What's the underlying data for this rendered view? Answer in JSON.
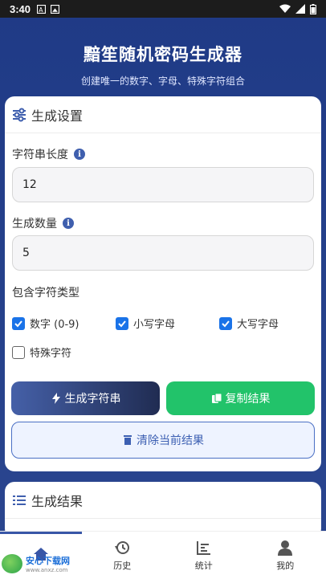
{
  "status_bar": {
    "time": "3:40"
  },
  "header": {
    "title": "黯笙随机密码生成器",
    "subtitle": "创建唯一的数字、字母、特殊字符组合"
  },
  "settings": {
    "title": "生成设置",
    "length_label": "字符串长度",
    "length_value": "12",
    "count_label": "生成数量",
    "count_value": "5",
    "types_label": "包含字符类型",
    "types": [
      {
        "label": "数字 (0-9)",
        "checked": true
      },
      {
        "label": "小写字母",
        "checked": true
      },
      {
        "label": "大写字母",
        "checked": true
      },
      {
        "label": "特殊字符",
        "checked": false
      }
    ],
    "generate_label": "生成字符串",
    "copy_label": "复制结果",
    "clear_label": "清除当前结果"
  },
  "results": {
    "title": "生成结果"
  },
  "nav": {
    "items": [
      {
        "label": "",
        "icon": "home-icon",
        "active": true
      },
      {
        "label": "历史",
        "icon": "history-icon",
        "active": false
      },
      {
        "label": "统计",
        "icon": "chart-icon",
        "active": false
      },
      {
        "label": "我的",
        "icon": "user-icon",
        "active": false
      }
    ]
  },
  "watermark": {
    "text": "安心下载网",
    "sub": "www.anxz.com"
  },
  "colors": {
    "accent": "#3856a7",
    "checkbox": "#1a73e8",
    "copy_green": "#22c36a"
  }
}
